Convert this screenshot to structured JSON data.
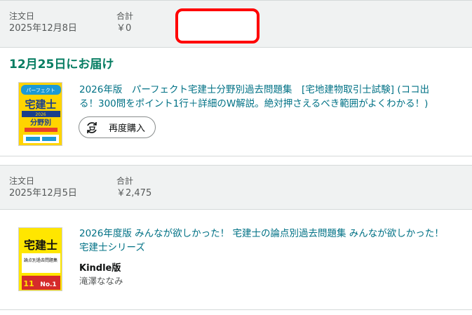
{
  "orders": [
    {
      "date_label": "注文日",
      "date_value": "2025年12月8日",
      "total_label": "合計",
      "total_value": "￥0",
      "delivery": "12月25日にお届け",
      "product_title_line1": "2026年版　パーフェクト宅建士分野別過去問題集　[宅地建物取引士試験] (ココ出",
      "product_title_line2": "る！300問をポイント1行＋詳細のW解説。絶対押さえるべき範囲がよくわかる！)",
      "reorder_label": "再度購入",
      "cover": {
        "brand": "パーフェクト",
        "main": "宅建士",
        "sub": "分野別",
        "year": "2026"
      }
    },
    {
      "date_label": "注文日",
      "date_value": "2025年12月5日",
      "total_label": "合計",
      "total_value": "￥2,475",
      "product_title_line1": "2026年度版 みんなが欲しかった！ 宅建士の論点別過去問題集 みんなが欲しかった！",
      "product_title_line2": "宅建士シリーズ",
      "format": "Kindle版",
      "author": "滝澤ななみ",
      "cover": {
        "main": "宅建士",
        "sub": "論点別過去問題集",
        "badge": "No.1",
        "vol": "11"
      }
    }
  ],
  "colors": {
    "header_bg": "#f0f2f2",
    "link": "#007185",
    "delivery_green": "#067d62",
    "highlight_red": "#ff0000"
  }
}
